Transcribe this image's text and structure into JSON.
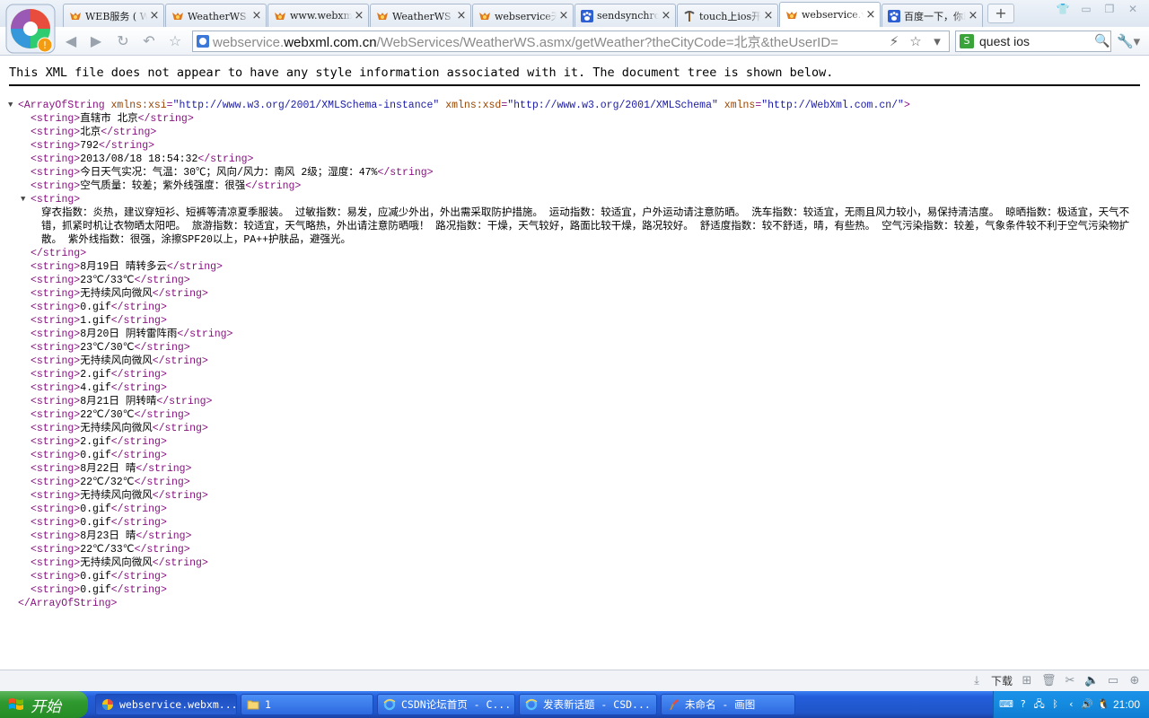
{
  "browser": {
    "tabs": [
      {
        "title": "WEB服务 ( WebXml.com.cn",
        "icon": "fox-icon",
        "active": false
      },
      {
        "title": "WeatherWS Web 服务",
        "icon": "fox-icon",
        "active": false
      },
      {
        "title": "www.webxml.com.cn",
        "icon": "fox-icon",
        "active": false
      },
      {
        "title": "WeatherWS Web 服务",
        "icon": "fox-icon",
        "active": false
      },
      {
        "title": "webservice天气预报",
        "icon": "fox-icon",
        "active": false
      },
      {
        "title": "sendsynchronous",
        "icon": "baidu-paw-icon",
        "active": false
      },
      {
        "title": "touch上ios开发",
        "icon": "pickaxe-icon",
        "active": false
      },
      {
        "title": "webservice.webxml",
        "icon": "fox-icon",
        "active": true
      },
      {
        "title": "百度一下，你就知道",
        "icon": "baidu-paw-icon",
        "active": false
      }
    ],
    "new_tab_label": "+",
    "address": {
      "prefix": "webservice.",
      "host": "webxml.com.cn",
      "path": "/WebServices/WeatherWS.asmx/getWeather?theCityCode=北京&theUserID="
    },
    "search_text": "quest ios",
    "search_engine_icon": "S",
    "download_label": "下载"
  },
  "xml": {
    "notice": "This XML file does not appear to have any style information associated with it. The document tree is shown below.",
    "root_open_tag": "<ArrayOfString",
    "root_attrs": [
      {
        "name": "xmlns:xsi",
        "value": "\"http://www.w3.org/2001/XMLSchema-instance\""
      },
      {
        "name": "xmlns:xsd",
        "value": "\"http://www.w3.org/2001/XMLSchema\""
      },
      {
        "name": "xmlns",
        "value": "\"http://WebXml.com.cn/\""
      }
    ],
    "root_close": "</ArrayOfString>",
    "open_tag": "<string>",
    "close_tag": "</string>",
    "strings_before": [
      "直辖市 北京",
      "北京",
      "792",
      "2013/08/18 18:54:32",
      "今日天气实况：气温：30℃；风向/风力：南风 2级；湿度：47%",
      "空气质量：较差；紫外线强度：很强"
    ],
    "indices": "穿衣指数：炎热，建议穿短衫、短裤等清凉夏季服装。 过敏指数：易发，应减少外出，外出需采取防护措施。 运动指数：较适宜，户外运动请注意防晒。 洗车指数：较适宜，无雨且风力较小，易保持清洁度。 晾晒指数：极适宜，天气不错，抓紧时机让衣物晒太阳吧。 旅游指数：较适宜，天气略热，外出请注意防晒哦！ 路况指数：干燥，天气较好，路面比较干燥，路况较好。 舒适度指数：较不舒适，晴，有些热。 空气污染指数：较差，气象条件较不利于空气污染物扩散。 紫外线指数：很强，涂擦SPF20以上，PA++护肤品，避强光。",
    "strings_after": [
      "8月19日 晴转多云",
      "23℃/33℃",
      "无持续风向微风",
      "0.gif",
      "1.gif",
      "8月20日 阴转雷阵雨",
      "23℃/30℃",
      "无持续风向微风",
      "2.gif",
      "4.gif",
      "8月21日 阴转晴",
      "22℃/30℃",
      "无持续风向微风",
      "2.gif",
      "0.gif",
      "8月22日 晴",
      "22℃/32℃",
      "无持续风向微风",
      "0.gif",
      "0.gif",
      "8月23日 晴",
      "22℃/33℃",
      "无持续风向微风",
      "0.gif",
      "0.gif"
    ]
  },
  "taskbar": {
    "start_label": "开始",
    "items": [
      {
        "label": "webservice.webxm...",
        "icon": "browser-icon",
        "active": true
      },
      {
        "label": "1",
        "icon": "folder-icon",
        "active": false
      },
      {
        "label": "CSDN论坛首页 - C...",
        "icon": "ie-icon",
        "active": false
      },
      {
        "label": "发表新话题 - CSD...",
        "icon": "ie-icon",
        "active": false
      },
      {
        "label": "未命名 - 画图",
        "icon": "paint-icon",
        "active": false
      }
    ],
    "clock": "21:00"
  },
  "colors": {
    "xml_tag": "#881280",
    "xml_attr_name": "#994500",
    "xml_attr_value": "#1a1aa6",
    "taskbar_blue": "#245edb",
    "start_green": "#2f9a2f"
  }
}
